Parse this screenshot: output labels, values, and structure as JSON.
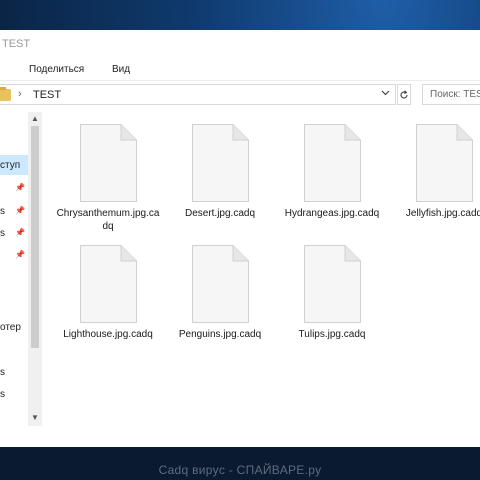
{
  "window": {
    "title": "TEST"
  },
  "ribbon": {
    "tabs": [
      "Поделиться",
      "Вид"
    ]
  },
  "address": {
    "path": "TEST",
    "separator": "›",
    "dropdown_icon": "chevron-down-icon",
    "refresh_icon": "refresh-icon"
  },
  "search": {
    "placeholder": "Поиск: TEST"
  },
  "nav": {
    "items": [
      {
        "label": "ступ",
        "pinned": false
      },
      {
        "label": "",
        "pinned": true
      },
      {
        "label": "s",
        "pinned": true
      },
      {
        "label": "s",
        "pinned": true
      },
      {
        "label": "",
        "pinned": true
      },
      {
        "label": "отер",
        "pinned": false
      },
      {
        "label": "s",
        "pinned": false
      },
      {
        "label": "s",
        "pinned": false
      }
    ]
  },
  "files": [
    {
      "name": "Chrysanthemum.jpg.cadq"
    },
    {
      "name": "Desert.jpg.cadq"
    },
    {
      "name": "Hydrangeas.jpg.cadq"
    },
    {
      "name": "Jellyfish.jpg.cadq"
    },
    {
      "name": "Lighthouse.jpg.cadq"
    },
    {
      "name": "Penguins.jpg.cadq"
    },
    {
      "name": "Tulips.jpg.cadq"
    }
  ],
  "watermark": {
    "text": "Cadq вирус - СПАЙВАРЕ.ру"
  },
  "colors": {
    "selection": "#cce8ff",
    "folder": "#e8c25c",
    "desktop": "#0f3a6e"
  }
}
